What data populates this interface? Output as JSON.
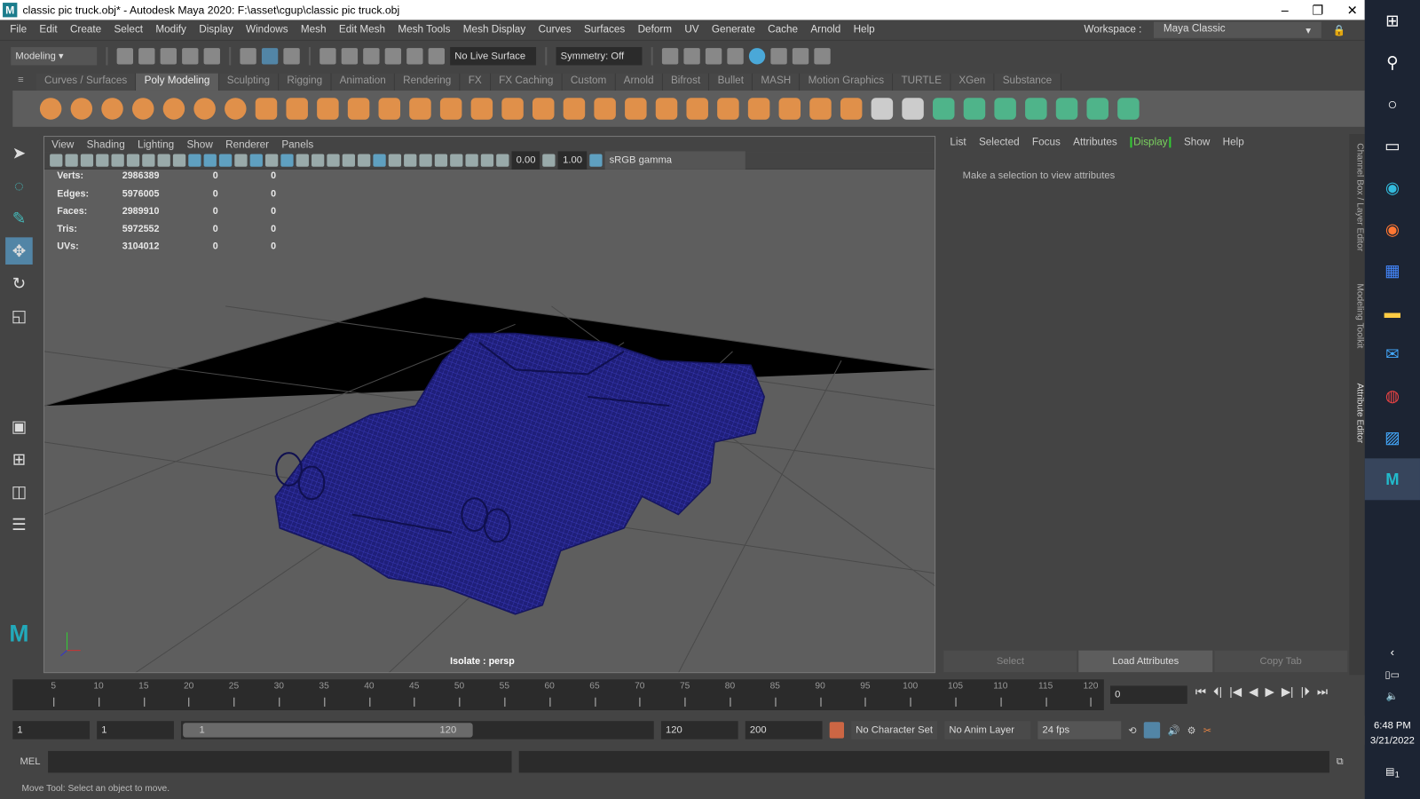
{
  "window": {
    "title": "classic pic truck.obj* - Autodesk Maya 2020: F:\\asset\\cgup\\classic pic truck.obj",
    "logo": "M",
    "min": "–",
    "max": "❐",
    "close": "✕"
  },
  "menu": [
    "File",
    "Edit",
    "Create",
    "Select",
    "Modify",
    "Display",
    "Windows",
    "Mesh",
    "Edit Mesh",
    "Mesh Tools",
    "Mesh Display",
    "Curves",
    "Surfaces",
    "Deform",
    "UV",
    "Generate",
    "Cache",
    "Arnold",
    "Help"
  ],
  "workspace": {
    "label": "Workspace :",
    "value": "Maya Classic"
  },
  "statusline": {
    "menuset": "Modeling",
    "live_surface": "No Live Surface",
    "symmetry": "Symmetry: Off"
  },
  "shelf_tabs": [
    "Curves / Surfaces",
    "Poly Modeling",
    "Sculpting",
    "Rigging",
    "Animation",
    "Rendering",
    "FX",
    "FX Caching",
    "Custom",
    "Arnold",
    "Bifrost",
    "Bullet",
    "MASH",
    "Motion Graphics",
    "TURTLE",
    "XGen",
    "Substance"
  ],
  "shelf_icons": [
    "poly-sphere",
    "poly-cube",
    "poly-cylinder",
    "poly-cone",
    "poly-torus",
    "poly-plane",
    "poly-disc",
    "platonic",
    "super-shape",
    "type",
    "svg",
    "measure",
    "center-pivot",
    "freeze",
    "combine",
    "separate",
    "mirror",
    "smooth",
    "reduce",
    "bridge",
    "extrude",
    "bevel",
    "boolean",
    "fill-hole",
    "append",
    "merge",
    "multi-cut",
    "target-weld",
    "quad-draw",
    "uv-planar",
    "uv-cylinder",
    "uv-sphere",
    "uv-auto",
    "uv-unfold",
    "uv-editor",
    "uv-checker"
  ],
  "shelf_icon_colors": {
    "poly": "#e0904a",
    "uv": "#4fb48a",
    "tool": "#cccccc"
  },
  "viewport": {
    "menu": [
      "View",
      "Shading",
      "Lighting",
      "Show",
      "Renderer",
      "Panels"
    ],
    "exposure": "0.00",
    "gamma": "1.00",
    "color_space": "sRGB gamma",
    "label": "Isolate : persp",
    "stats": [
      [
        "Verts:",
        "2986389",
        "0",
        "0"
      ],
      [
        "Edges:",
        "5976005",
        "0",
        "0"
      ],
      [
        "Faces:",
        "2989910",
        "0",
        "0"
      ],
      [
        "Tris:",
        "5972552",
        "0",
        "0"
      ],
      [
        "UVs:",
        "3104012",
        "0",
        "0"
      ]
    ]
  },
  "channel_box": {
    "menu": [
      "List",
      "Selected",
      "Focus",
      "Attributes",
      "Display",
      "Show",
      "Help"
    ],
    "active": "Display",
    "message": "Make a selection to view attributes",
    "buttons": [
      "Select",
      "Load Attributes",
      "Copy Tab"
    ]
  },
  "side_tabs": [
    "Channel Box / Layer Editor",
    "Modeling Toolkit",
    "Attribute Editor"
  ],
  "timeline": {
    "ticks": [
      "5",
      "10",
      "15",
      "20",
      "25",
      "30",
      "35",
      "40",
      "45",
      "50",
      "55",
      "60",
      "65",
      "70",
      "75",
      "80",
      "85",
      "90",
      "95",
      "100",
      "105",
      "110",
      "115",
      "120"
    ],
    "current": "0"
  },
  "range": {
    "start": "1",
    "playback_start": "1",
    "slider_start": "1",
    "slider_end": "120",
    "playback_end": "120",
    "end": "200",
    "character_set": "No Character Set",
    "anim_layer": "No Anim Layer",
    "fps": "24 fps"
  },
  "mel": {
    "label": "MEL"
  },
  "help_line": "Move Tool: Select an object to move.",
  "taskbar": {
    "time": "6:48 PM",
    "date": "3/21/2022",
    "notif": "1"
  }
}
